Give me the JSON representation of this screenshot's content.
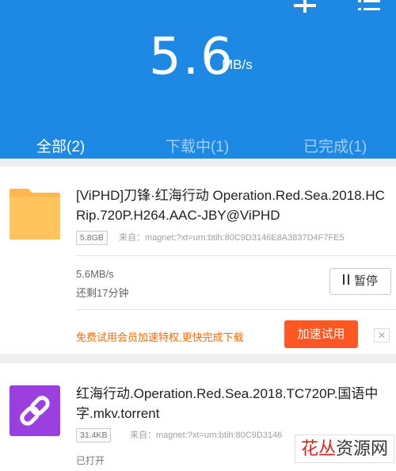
{
  "header": {
    "speed_value": "5.6",
    "speed_unit": "MB/s",
    "add_icon": "plus-icon",
    "menu_icon": "list-menu-icon",
    "background_color": "#1e88e5"
  },
  "tabs": [
    {
      "label": "全部(2)",
      "active": true
    },
    {
      "label": "下载中(1)",
      "active": false
    },
    {
      "label": "已完成(1)",
      "active": false
    }
  ],
  "downloads": [
    {
      "icon": "folder-icon",
      "title": "[ViPHD]刀锋·红海行动 Operation.Red.Sea.2018.HCRip.720P.H264.AAC-JBY@ViPHD",
      "size": "5.8GB",
      "source": "来自：magnet:?xt=urn:btih:80C9D3146E8A3837D4F7FE5",
      "rate": "5.6MB/s",
      "remaining": "还剩17分钟",
      "pause_label": "暂停",
      "promo_text": "免费试用会员加速特权,更快完成下载",
      "boost_label": "加速试用",
      "close_label": "✕"
    },
    {
      "icon": "link-icon",
      "title": "红海行动.Operation.Red.Sea.2018.TC720P.国语中字.mkv.torrent",
      "size": "31.4KB",
      "source": "来自：magnet:?xt=urn:btih:80C9D3146",
      "status": "已打开"
    }
  ],
  "watermark": {
    "part1": "花丛",
    "part2": "资源网"
  },
  "colors": {
    "accent": "#1e88e5",
    "boost": "#ff5722",
    "promo": "#ff6a00",
    "torrent_icon": "#9c3fe0",
    "folder": "#ffb74d"
  }
}
